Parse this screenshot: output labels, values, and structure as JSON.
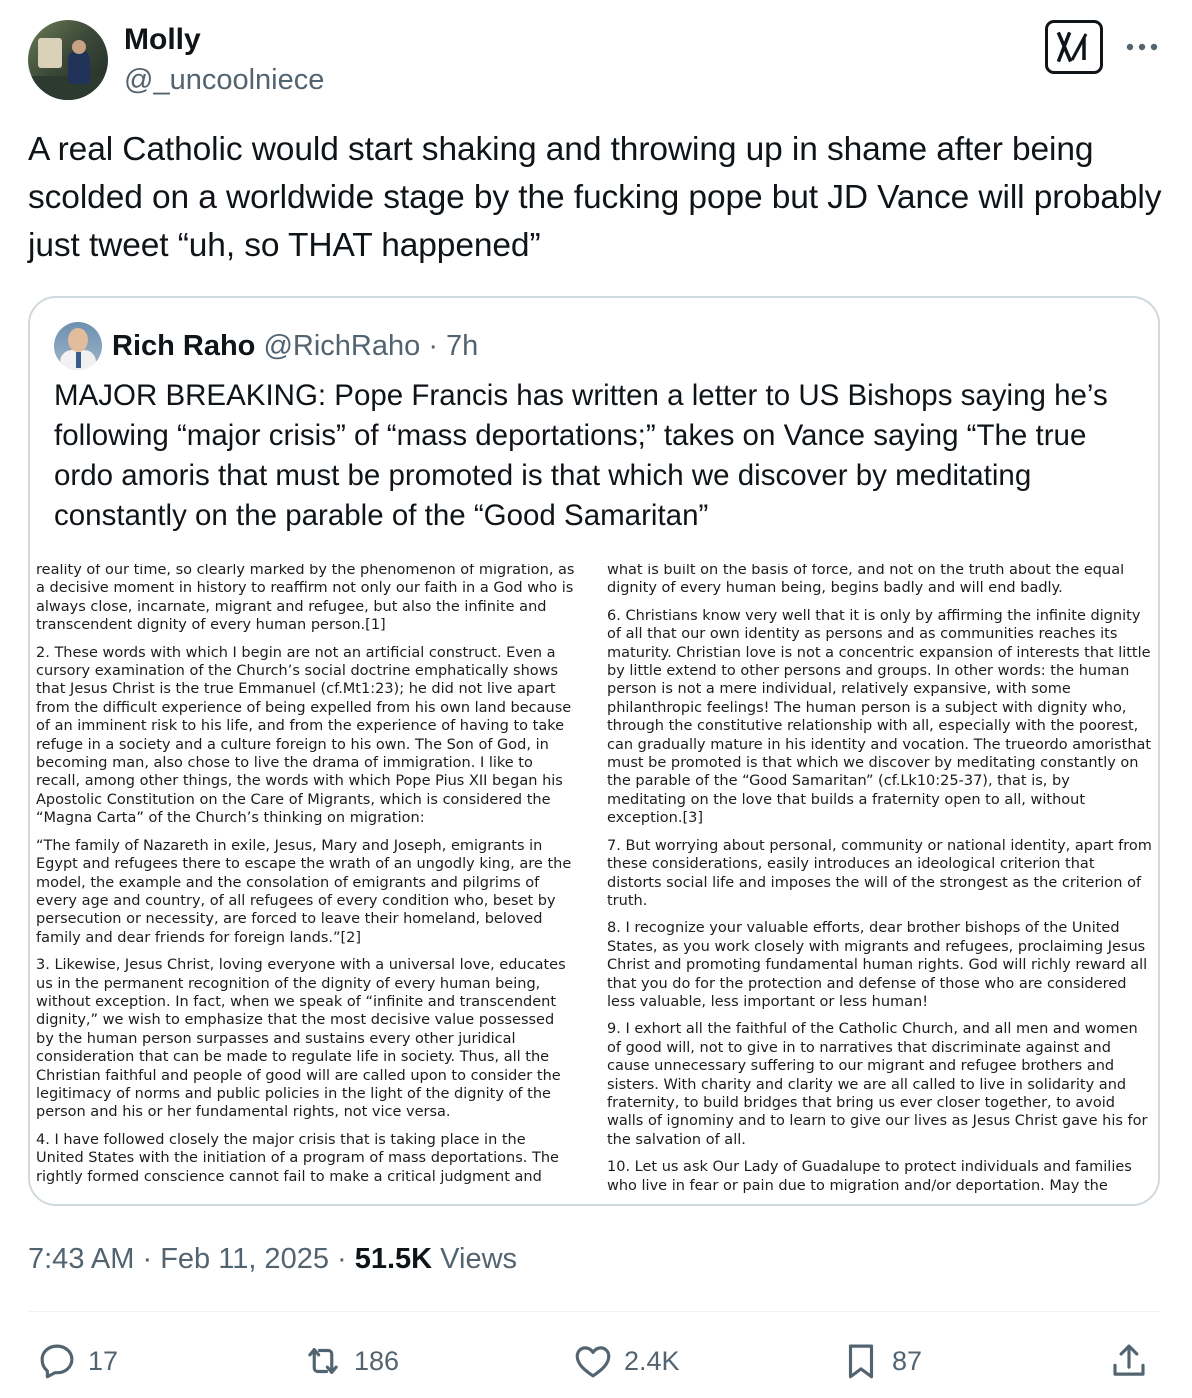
{
  "author": {
    "name": "Molly",
    "handle": "@_uncoolniece"
  },
  "tweet": {
    "text": "A real Catholic would start shaking and throwing up in shame after being scolded on a worldwide stage by the fucking pope but JD Vance will probably just tweet “uh, so THAT happened”"
  },
  "quote": {
    "author_name": "Rich Raho",
    "author_handle": "@RichRaho",
    "time": "· 7h",
    "text": "MAJOR BREAKING: Pope Francis has written a letter to US Bishops saying he’s following “major crisis” of “mass deportations;” takes on Vance saying “The true ordo amoris that must be promoted is that which we discover by meditating constantly on the parable of the “Good Samaritan”",
    "document": {
      "left": [
        "reality of our time, so clearly marked by the phenomenon of migration, as a decisive moment in history to reaffirm not only our faith in a God who is always close, incarnate, migrant and refugee, but also the infinite and transcendent dignity of every human person.[1]",
        "2. These words with which I begin are not an artificial construct. Even a cursory examination of the Church’s social doctrine emphatically shows that Jesus Christ is the true Emmanuel (cf.Mt1:23); he did not live apart from the difficult experience of being expelled from his own land because of an imminent risk to his life, and from the experience of having to take refuge in a society and a culture foreign to his own. The Son of God, in becoming man, also chose to live the drama of immigration. I like to recall, among other things, the words with which Pope Pius XII began his Apostolic Constitution on the Care of Migrants, which is considered the “Magna Carta” of the Church’s thinking on migration:",
        "“The family of Nazareth in exile, Jesus, Mary and Joseph, emigrants in Egypt and refugees there to escape the wrath of an ungodly king, are the model, the example and the consolation of emigrants and pilgrims of every age and country, of all refugees of every condition who, beset by persecution or necessity, are forced to leave their homeland, beloved family and dear friends for foreign lands.”[2]",
        "3. Likewise, Jesus Christ, loving everyone with a universal love, educates us in the permanent recognition of the dignity of every human being, without exception. In fact, when we speak of “infinite and transcendent dignity,” we wish to emphasize that the most decisive value possessed by the human person surpasses and sustains every other juridical consideration that can be made to regulate life in society. Thus, all the Christian faithful and people of good will are called upon to consider the legitimacy of norms and public policies in the light of the dignity of the person and his or her fundamental rights, not vice versa.",
        "4. I have followed closely the major crisis that is taking place in the United States with the initiation of a program of mass deportations. The rightly formed conscience cannot fail to make a critical judgment and"
      ],
      "right": [
        "what is built on the basis of force, and not on the truth about the equal dignity of every human being, begins badly and will end badly.",
        "6. Christians know very well that it is only by affirming the infinite dignity of all that our own identity as persons and as communities reaches its maturity. Christian love is not a concentric expansion of interests that little by little extend to other persons and groups. In other words: the human person is not a mere individual, relatively expansive, with some philanthropic feelings! The human person is a subject with dignity who, through the constitutive relationship with all, especially with the poorest, can gradually mature in his identity and vocation. The trueordo amoristhat must be promoted is that which we discover by meditating constantly on the parable of the “Good Samaritan” (cf.Lk10:25-37), that is, by meditating on the love that builds a fraternity open to all, without exception.[3]",
        "7. But worrying about personal, community or national identity, apart from these considerations, easily introduces an ideological criterion that distorts social life and imposes the will of the strongest as the criterion of truth.",
        "8. I recognize your valuable efforts, dear brother bishops of the United States, as you work closely with migrants and refugees, proclaiming Jesus Christ and promoting fundamental human rights. God will richly reward all that you do for the protection and defense of those who are considered less valuable, less important or less human!",
        "9. I exhort all the faithful of the Catholic Church, and all men and women of good will, not to give in to narratives that discriminate against and cause unnecessary suffering to our migrant and refugee brothers and sisters. With charity and clarity we are all called to live in solidarity and fraternity, to build bridges that bring us ever closer together, to avoid walls of ignominy and to learn to give our lives as Jesus Christ gave his for the salvation of all.",
        "10. Let us ask Our Lady of Guadalupe to protect individuals and families who live in fear or pain due to migration and/or deportation. May the"
      ]
    }
  },
  "meta": {
    "time": "7:43 AM",
    "sep1": " · ",
    "date": "Feb 11, 2025",
    "sep2": " · ",
    "views_count": "51.5K",
    "views_label": " Views"
  },
  "actions": {
    "replies": "17",
    "reposts": "186",
    "likes": "2.4K",
    "bookmarks": "87"
  },
  "icons": [
    "grok-icon",
    "more-icon",
    "reply-icon",
    "repost-icon",
    "like-icon",
    "bookmark-icon",
    "share-icon"
  ]
}
